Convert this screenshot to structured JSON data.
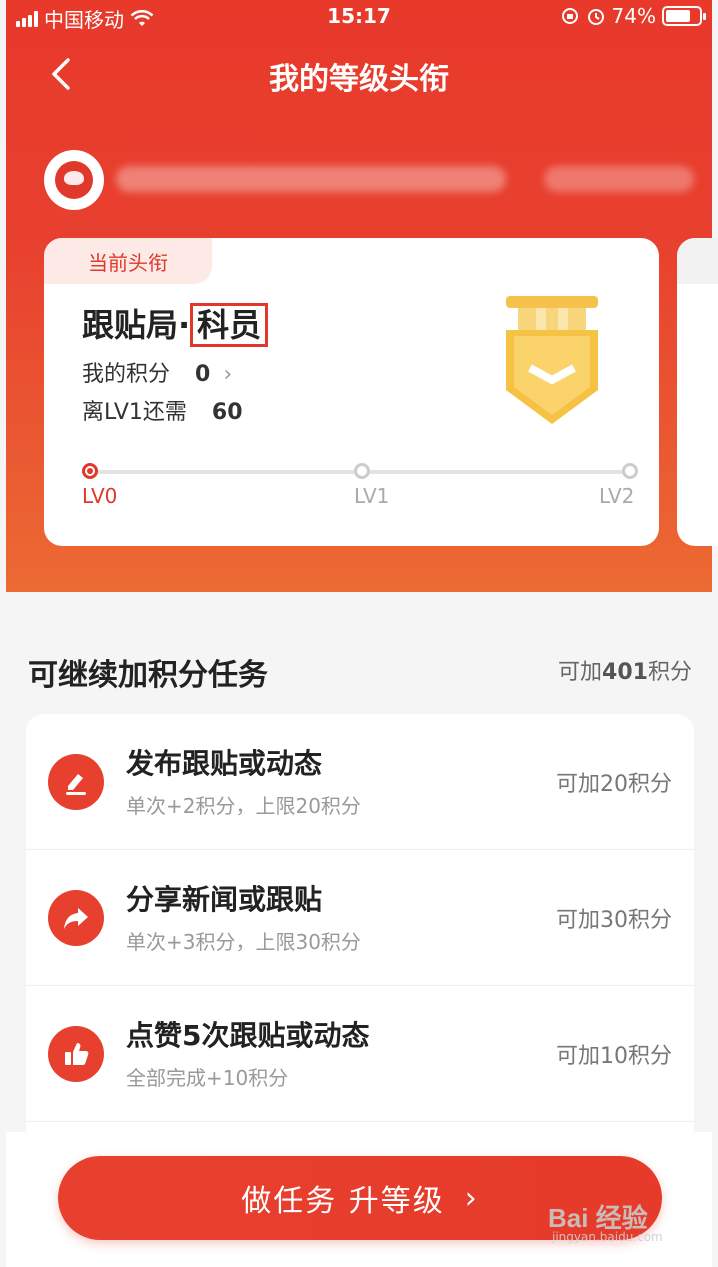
{
  "status_bar": {
    "carrier": "中国移动",
    "time": "15:17",
    "battery": "74%",
    "battery_level": 0.74
  },
  "nav": {
    "title": "我的等级头衔",
    "back_icon": "chevron-left-icon"
  },
  "level_card": {
    "badge": "当前头衔",
    "title_prefix": "跟贴局·",
    "title_rank": "科员",
    "score_label": "我的积分",
    "score_value": "0",
    "need_label": "离LV1还需",
    "need_value": "60",
    "levels": [
      "LV0",
      "LV1",
      "LV2"
    ],
    "medal_icon": "medal-icon"
  },
  "tasks": {
    "header": "可继续加积分任务",
    "total_prefix": "可加",
    "total_value": "401",
    "total_suffix": "积分",
    "items": [
      {
        "icon": "edit-icon",
        "title": "发布跟贴或动态",
        "desc": "单次+2积分，上限20积分",
        "points": "可加20积分"
      },
      {
        "icon": "share-icon",
        "title": "分享新闻或跟贴",
        "desc": "单次+3积分，上限30积分",
        "points": "可加30积分"
      },
      {
        "icon": "thumbs-up-icon",
        "title": "点赞5次跟贴或动态",
        "desc": "全部完成+10积分",
        "points": "可加10积分"
      }
    ]
  },
  "cta": {
    "label": "做任务 升等级",
    "arrow": "›"
  },
  "watermark": {
    "text": "Bai 经验",
    "sub": "jingyan.baidu.com"
  },
  "colors": {
    "primary": "#e8392b",
    "gradient_end": "#ec6a33",
    "medal": "#f6c244"
  }
}
